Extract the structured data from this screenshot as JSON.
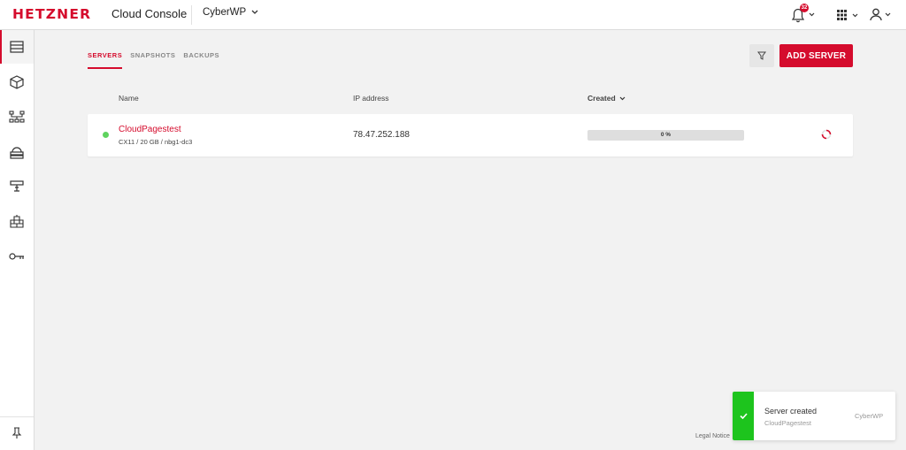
{
  "header": {
    "logo": "HETZNER",
    "app_title": "Cloud Console",
    "project": "CyberWP",
    "notifications_count": "32"
  },
  "sidebar": {
    "items": [
      {
        "name": "servers",
        "icon": "server-icon",
        "active": true
      },
      {
        "name": "volumes",
        "icon": "box-icon"
      },
      {
        "name": "networks",
        "icon": "network-icon"
      },
      {
        "name": "load-balancers",
        "icon": "load-balancer-icon"
      },
      {
        "name": "floating-ips",
        "icon": "floating-ip-icon"
      },
      {
        "name": "firewalls",
        "icon": "firewall-icon"
      },
      {
        "name": "security",
        "icon": "key-icon"
      }
    ],
    "pin_icon": "pin-icon"
  },
  "tabs": [
    {
      "label": "SERVERS",
      "active": true
    },
    {
      "label": "SNAPSHOTS",
      "active": false
    },
    {
      "label": "BACKUPS",
      "active": false
    }
  ],
  "toolbar": {
    "filter_icon": "filter-icon",
    "add_label": "ADD SERVER"
  },
  "table": {
    "columns": {
      "name": "Name",
      "ip": "IP address",
      "created": "Created"
    },
    "rows": [
      {
        "name": "CloudPagestest",
        "spec": "CX11 / 20 GB / nbg1-dc3",
        "ip": "78.47.252.188",
        "progress_text": "0 %",
        "progress": 0,
        "status_color": "#5fd35f"
      }
    ]
  },
  "footer": {
    "legal": "Legal Notice"
  },
  "toast": {
    "title": "Server created",
    "subtitle": "CloudPagestest",
    "project": "CyberWP",
    "color": "#1dc41d"
  },
  "colors": {
    "accent": "#d50c2d"
  }
}
